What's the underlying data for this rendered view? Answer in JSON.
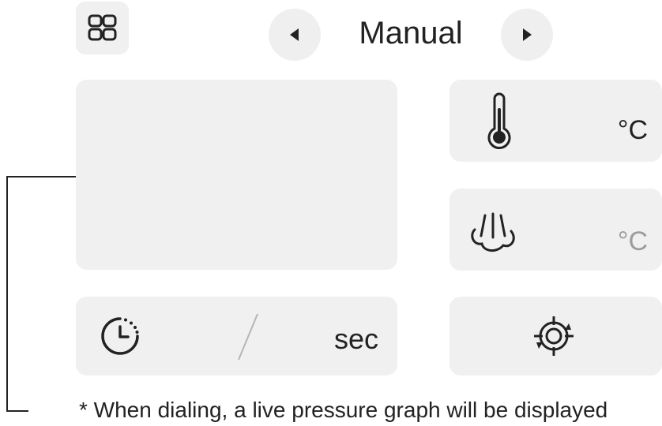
{
  "header": {
    "mode_title": "Manual"
  },
  "cards": {
    "temperature_unit": "°C",
    "steam_unit": "°C",
    "timer_unit": "sec"
  },
  "footnote": {
    "text": "* When dialing, a live pressure graph will be displayed"
  },
  "icons": {
    "menu": "grid-icon",
    "prev": "caret-left-icon",
    "next": "caret-right-icon",
    "temperature": "thermometer-icon",
    "steam": "steam-icon",
    "timer": "timer-icon",
    "purge": "purge-target-icon"
  },
  "colors": {
    "tile_background": "#f0f0f0",
    "text_primary": "#222222",
    "steam_unit_muted": "#9c9c9c"
  }
}
